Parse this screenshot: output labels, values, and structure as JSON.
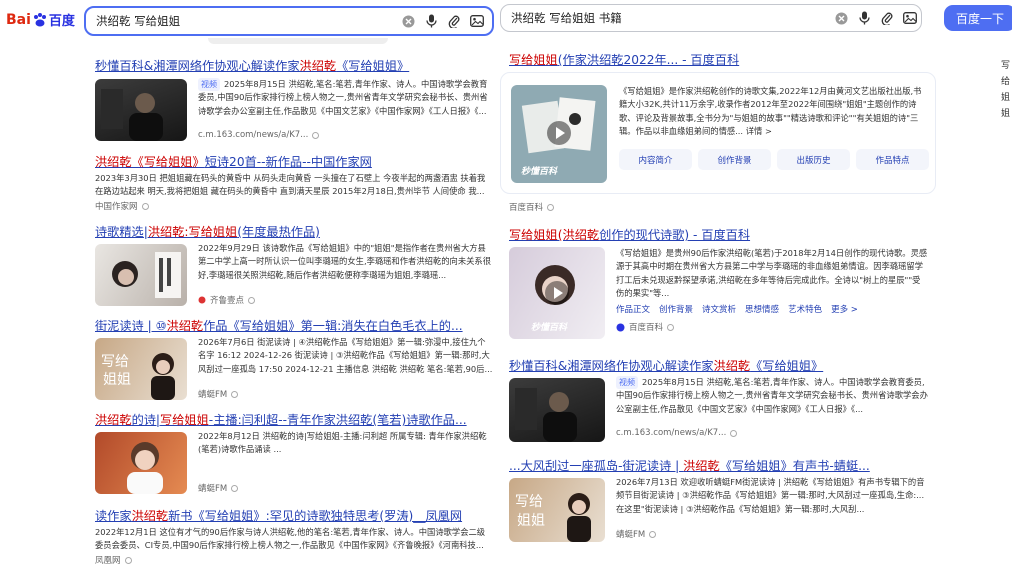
{
  "left": {
    "logo": {
      "bai": "Bai",
      "du": "百度"
    },
    "search": {
      "query": "洪绍乾 写给姐姐"
    },
    "results": [
      {
        "title_parts": [
          [
            "秒懂百科&湘潭网络作协观心解读作家",
            0
          ],
          [
            "洪绍乾",
            1
          ],
          [
            "《写给姐姐》",
            0
          ]
        ],
        "badge": "视频",
        "snippet": "2025年8月15日 洪绍乾,笔名:笔若,青年作家、诗人。中国诗歌学会教育委员,中国90后作家排行榜上榜人物之一,贵州省青年文学研究会秘书长、贵州省诗歌学会办公室副主任,作品散见《中国文艺家》《中国作家网》《工人日报》《...",
        "source": "c.m.163.com/news/a/K7..."
      },
      {
        "title_parts": [
          [
            "洪绍乾《写给姐姐》",
            1
          ],
          [
            "短诗20首--新作品--中国作家网",
            0
          ]
        ],
        "snippet": "2023年3月30日 把姐姐藏在码头的黄昏中 从码头走向黄昏 一头撞在了石壁上 今夜半起的两盏酒盅 扶着我在路边站起来 明天,我将把姐姐 藏在码头的黄昏中 直到满天星辰 2015年2月18日,贵州毕节 人间使命 我...",
        "source": "中国作家网"
      },
      {
        "title_parts": [
          [
            "诗歌精选|",
            0
          ],
          [
            "洪绍乾:写给姐姐",
            1
          ],
          [
            "(年度最热作品)",
            0
          ]
        ],
        "snippet": "2022年9月29日 该诗歌作品《写给姐姐》中的\"姐姐\"是指作者在贵州省大方县第二中学上高一时所认识一位叫李璐瑶的女生,李璐瑶和作者洪绍乾的向未关系很好,李璐瑶很关照洪绍乾,随后作者洪绍乾便称李璐瑶为姐姐,李璐瑶...",
        "source": "齐鲁壹点"
      },
      {
        "title_parts": [
          [
            "街泥读诗 | ⑩",
            0
          ],
          [
            "洪绍乾",
            1
          ],
          [
            "作品《写给姐姐》第一辑:消失在白色毛衣上的...",
            0
          ]
        ],
        "snippet": "2026年7月6日 街泥读诗 | ④洪绍乾作品《写给姐姐》第一辑:弥漫中,接住九个名字 16:12 2024-12-26 街泥读诗 | ③洪绍乾作品《写给姐姐》第一辑:那时,大风刮过一座孤岛 17:50 2024-12-21 主播信息 洪绍乾 洪绍乾 笔名:笔若,90后...",
        "source": "蜻蜓FM"
      },
      {
        "title_parts": [
          [
            "洪绍乾",
            1
          ],
          [
            "的诗|",
            0
          ],
          [
            "写给姐姐",
            1
          ],
          [
            "-主播:闫利超--青年作家洪绍乾(笔若)诗歌作品...",
            0
          ]
        ],
        "snippet": "2022年8月12日 洪绍乾的诗|写给姐姐-主播:闫利超 所属专辑: 青年作家洪绍乾(笔若)诗歌作品诵读 ...",
        "source": "蜻蜓FM"
      },
      {
        "title_parts": [
          [
            "读作家",
            0
          ],
          [
            "洪绍乾",
            1
          ],
          [
            "新书《写给姐姐》:罕见的诗歌独特思考(罗涛)__凤凰网",
            0
          ]
        ],
        "snippet": "2022年12月1日 这位有才气的90后作家与诗人洪绍乾,他的笔名:笔若,青年作家、诗人。中国诗歌学会二级委员会委员、CI专员,中国90后作家排行榜上榜人物之一,作品散见《中国作家网》《齐鲁晚报》《河南科技...",
        "source": "凤凰网"
      }
    ]
  },
  "right": {
    "search": {
      "query": "洪绍乾 写给姐姐 书籍",
      "button": "百度一下"
    },
    "card": {
      "title_parts": [
        [
          "写给姐姐",
          1
        ],
        [
          "(作家洪绍乾2022年... - 百度百科",
          0
        ]
      ],
      "snippet": "《写给姐姐》是作家洪绍乾创作的诗歌文集,2022年12月由黄河文艺出版社出版,书籍大小32K,共计11万余字,收录作者2012年至2022年间围绕\"姐姐\"主题创作的诗歌、评论及背景故事,全书分为\"与姐姐的故事\"\"精选诗歌和评论\"\"有关姐姐的诗\"三辑。作品以非血缘姐弟间的情感... 详情 >",
      "tags": [
        "内容简介",
        "创作背景",
        "出版历史",
        "作品特点"
      ],
      "thumb_label": "秒懂百科",
      "source": "百度百科"
    },
    "results": [
      {
        "title_parts": [
          [
            "写给姐姐(洪绍乾",
            1
          ],
          [
            "创作的现代诗歌) - 百度百科",
            0
          ]
        ],
        "snippet": "《写给姐姐》是贵州90后作家洪绍乾(笔若)于2018年2月14日创作的现代诗歌。灵感源于其高中时期在贵州省大方县第二中学与李璐瑶的非血缘姐弟情谊。因李璐瑶留学打工后未兑现返黔探望承诺,洪绍乾在多年等待后完成此作。全诗以\"树上的星辰\"\"受伤的果实\"等...",
        "links": [
          "作品正文",
          "创作背景",
          "诗文赏析",
          "思想情感",
          "艺术特色",
          "更多 >"
        ],
        "thumb_label": "秒懂百科",
        "source": "百度百科"
      },
      {
        "title_parts": [
          [
            "秒懂百科&湘潭网络作协观心解读作家",
            0
          ],
          [
            "洪绍乾",
            1
          ],
          [
            "《写给姐姐》",
            0
          ]
        ],
        "badge": "视频",
        "snippet": "2025年8月15日 洪绍乾,笔名:笔若,青年作家、诗人。中国诗歌学会教育委员,中国90后作家排行榜上榜人物之一,贵州省青年文学研究会秘书长、贵州省诗歌学会办公室副主任,作品散见《中国文艺家》《中国作家网》《工人日报》《...",
        "source": "c.m.163.com/news/a/K7..."
      },
      {
        "title_parts": [
          [
            "...大风刮过一座孤岛-街泥读诗 | ",
            0
          ],
          [
            "洪绍乾",
            1
          ],
          [
            "《写给姐姐》有声书-蜻蜓...",
            0
          ]
        ],
        "snippet": "2026年7月13日 欢迎收听蜻蜓FM街泥读诗 | 洪绍乾《写给姐姐》有声书专辑下的音频节目街泥读诗 | ③洪绍乾作品《写给姐姐》第一辑:那时,大风刮过一座孤岛,生命:... 在这里\"街泥读诗 | ③洪绍乾作品《写给姐姐》第一辑:那时,大风刮...",
        "source": "蜻蜓FM"
      }
    ],
    "book_title": "写给姐姐"
  }
}
